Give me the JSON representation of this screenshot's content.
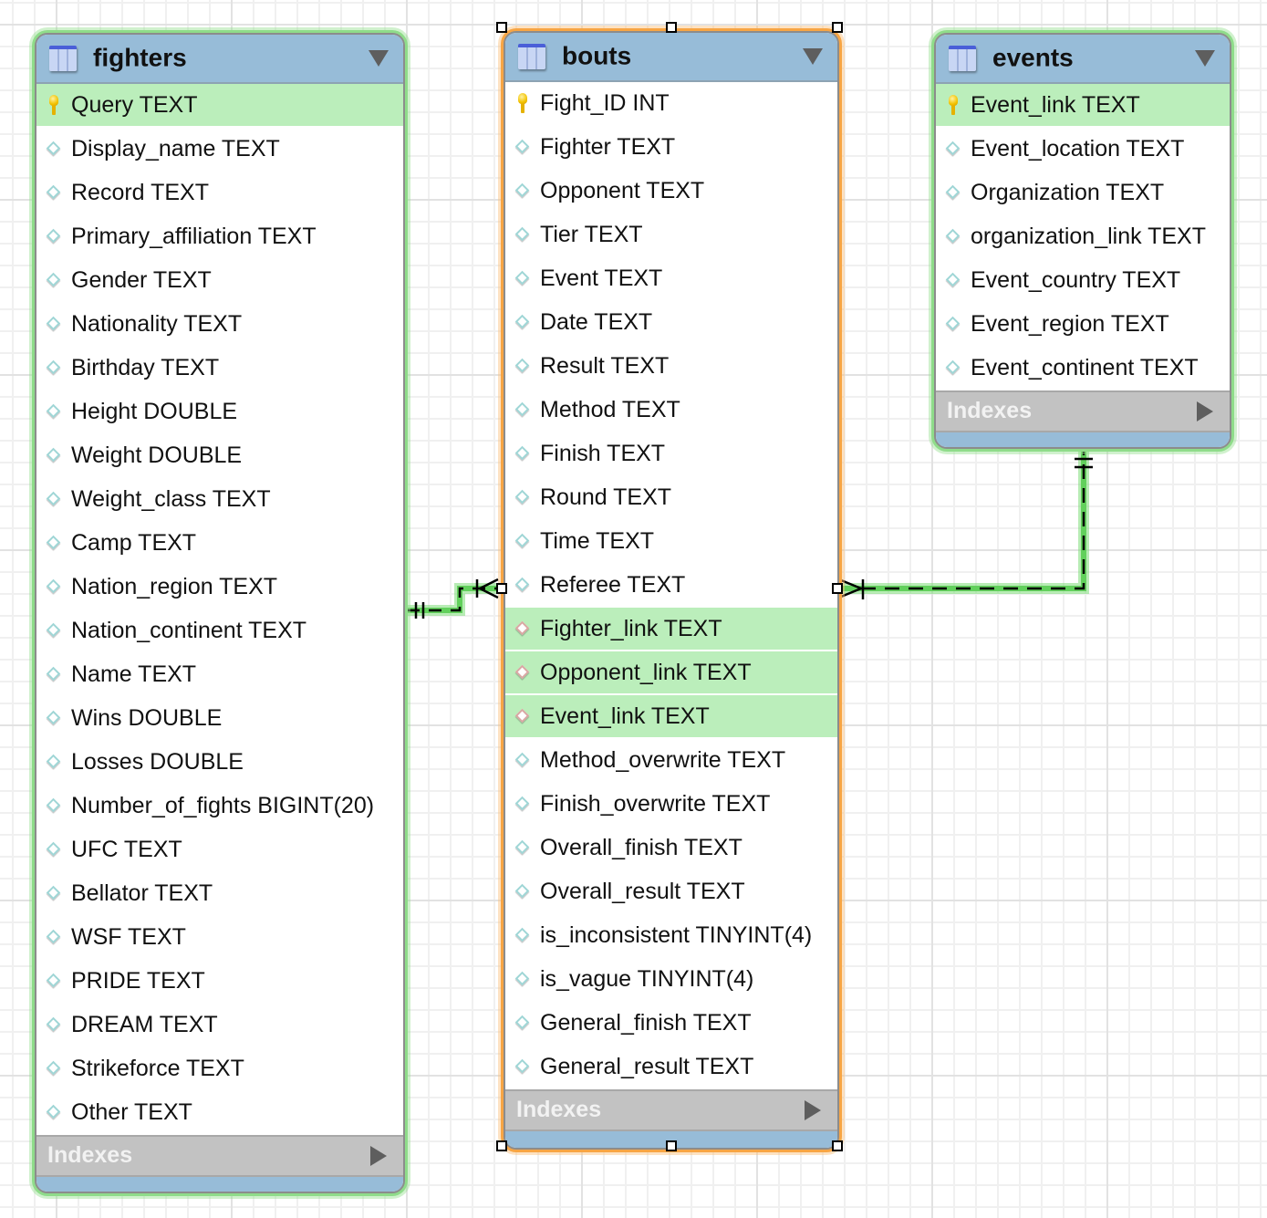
{
  "tables": {
    "fighters": {
      "name": "fighters",
      "indexes_label": "Indexes",
      "columns": [
        {
          "label": "Query TEXT",
          "kind": "pk",
          "highlighted": true
        },
        {
          "label": "Display_name TEXT",
          "kind": "col"
        },
        {
          "label": "Record TEXT",
          "kind": "col"
        },
        {
          "label": "Primary_affiliation TEXT",
          "kind": "col"
        },
        {
          "label": "Gender TEXT",
          "kind": "col"
        },
        {
          "label": "Nationality TEXT",
          "kind": "col"
        },
        {
          "label": "Birthday TEXT",
          "kind": "col"
        },
        {
          "label": "Height DOUBLE",
          "kind": "col"
        },
        {
          "label": "Weight DOUBLE",
          "kind": "col"
        },
        {
          "label": "Weight_class TEXT",
          "kind": "col"
        },
        {
          "label": "Camp TEXT",
          "kind": "col"
        },
        {
          "label": "Nation_region TEXT",
          "kind": "col"
        },
        {
          "label": "Nation_continent TEXT",
          "kind": "col"
        },
        {
          "label": "Name TEXT",
          "kind": "col"
        },
        {
          "label": "Wins DOUBLE",
          "kind": "col"
        },
        {
          "label": "Losses DOUBLE",
          "kind": "col"
        },
        {
          "label": "Number_of_fights BIGINT(20)",
          "kind": "col"
        },
        {
          "label": "UFC TEXT",
          "kind": "col"
        },
        {
          "label": "Bellator TEXT",
          "kind": "col"
        },
        {
          "label": "WSF TEXT",
          "kind": "col"
        },
        {
          "label": "PRIDE TEXT",
          "kind": "col"
        },
        {
          "label": "DREAM TEXT",
          "kind": "col"
        },
        {
          "label": "Strikeforce TEXT",
          "kind": "col"
        },
        {
          "label": "Other TEXT",
          "kind": "col"
        }
      ]
    },
    "bouts": {
      "name": "bouts",
      "indexes_label": "Indexes",
      "selected": true,
      "columns": [
        {
          "label": "Fight_ID INT",
          "kind": "pk"
        },
        {
          "label": "Fighter TEXT",
          "kind": "col"
        },
        {
          "label": "Opponent TEXT",
          "kind": "col"
        },
        {
          "label": "Tier TEXT",
          "kind": "col"
        },
        {
          "label": "Event TEXT",
          "kind": "col"
        },
        {
          "label": "Date TEXT",
          "kind": "col"
        },
        {
          "label": "Result TEXT",
          "kind": "col"
        },
        {
          "label": "Method TEXT",
          "kind": "col"
        },
        {
          "label": "Finish TEXT",
          "kind": "col"
        },
        {
          "label": "Round TEXT",
          "kind": "col"
        },
        {
          "label": "Time TEXT",
          "kind": "col"
        },
        {
          "label": "Referee TEXT",
          "kind": "col"
        },
        {
          "label": "Fighter_link TEXT",
          "kind": "fk",
          "highlighted": true
        },
        {
          "label": "Opponent_link TEXT",
          "kind": "fk",
          "highlighted": true
        },
        {
          "label": "Event_link TEXT",
          "kind": "fk",
          "highlighted": true
        },
        {
          "label": "Method_overwrite TEXT",
          "kind": "col"
        },
        {
          "label": "Finish_overwrite TEXT",
          "kind": "col"
        },
        {
          "label": "Overall_finish TEXT",
          "kind": "col"
        },
        {
          "label": "Overall_result TEXT",
          "kind": "col"
        },
        {
          "label": "is_inconsistent TINYINT(4)",
          "kind": "col"
        },
        {
          "label": "is_vague TINYINT(4)",
          "kind": "col"
        },
        {
          "label": "General_finish TEXT",
          "kind": "col"
        },
        {
          "label": "General_result TEXT",
          "kind": "col"
        }
      ]
    },
    "events": {
      "name": "events",
      "indexes_label": "Indexes",
      "columns": [
        {
          "label": "Event_link TEXT",
          "kind": "pk",
          "highlighted": true
        },
        {
          "label": "Event_location TEXT",
          "kind": "col"
        },
        {
          "label": "Organization TEXT",
          "kind": "col"
        },
        {
          "label": "organization_link TEXT",
          "kind": "col"
        },
        {
          "label": "Event_country TEXT",
          "kind": "col"
        },
        {
          "label": "Event_region TEXT",
          "kind": "col"
        },
        {
          "label": "Event_continent TEXT",
          "kind": "col"
        }
      ]
    }
  },
  "relationships": [
    {
      "from": "fighters",
      "to": "bouts",
      "from_cardinality": "one-and-only-one",
      "to_cardinality": "one-or-many",
      "identifying": false,
      "highlighted": true
    },
    {
      "from": "events",
      "to": "bouts",
      "from_cardinality": "one-and-only-one",
      "to_cardinality": "one-or-many",
      "identifying": false,
      "highlighted": true
    }
  ],
  "icons": {
    "table": "table-icon",
    "primary_key": "key-icon",
    "column": "diamond-icon",
    "foreign_key": "fk-diamond-icon",
    "collapse": "caret-down-icon",
    "expand_indexes": "caret-right-icon"
  },
  "colors": {
    "header": "#97bcd8",
    "highlight_row": "#bbeebb",
    "indexes_bar": "#c2c2c2",
    "selection_outline": "#f7a544",
    "relationship_highlight": "#6fd66a"
  }
}
